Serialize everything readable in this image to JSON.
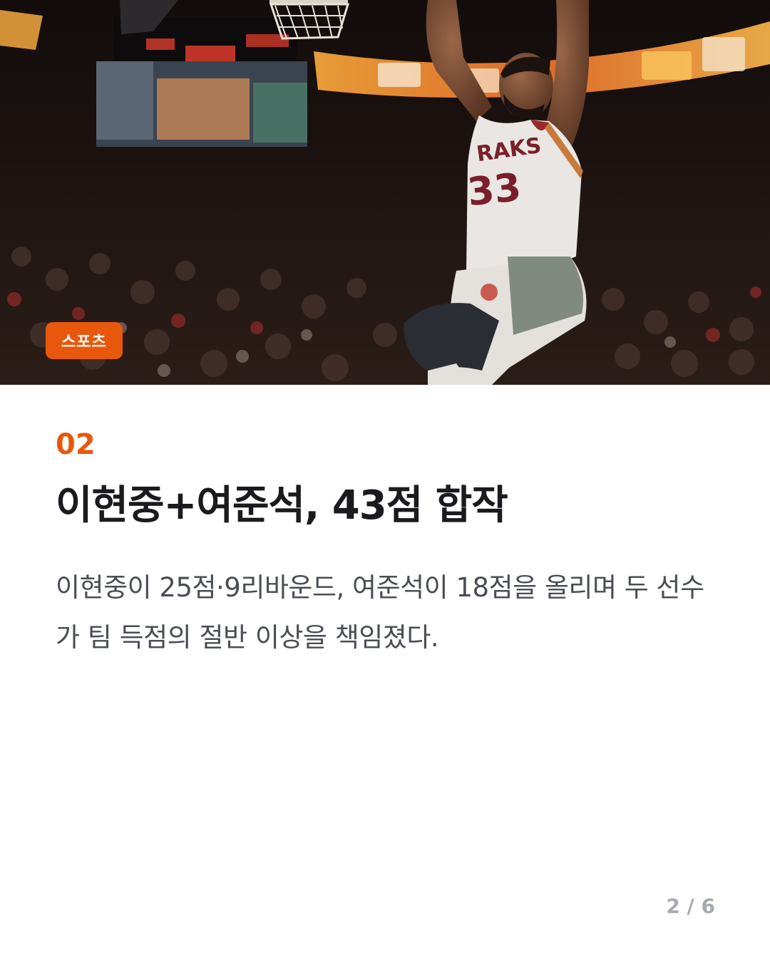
{
  "hero": {
    "category_badge": "스포츠"
  },
  "article": {
    "index": "02",
    "headline": "이현중+여준석, 43점 합작",
    "body": "이현중이 25점·9리바운드, 여준석이 18점을 올리며 두 선수가 팀 득점의 절반 이상을 책임졌다."
  },
  "pagination": {
    "label": "2 / 6"
  },
  "colors": {
    "accent": "#e8580c",
    "headline": "#1a1a1f",
    "body": "#4a4d55",
    "pager": "#a6a9b0"
  }
}
